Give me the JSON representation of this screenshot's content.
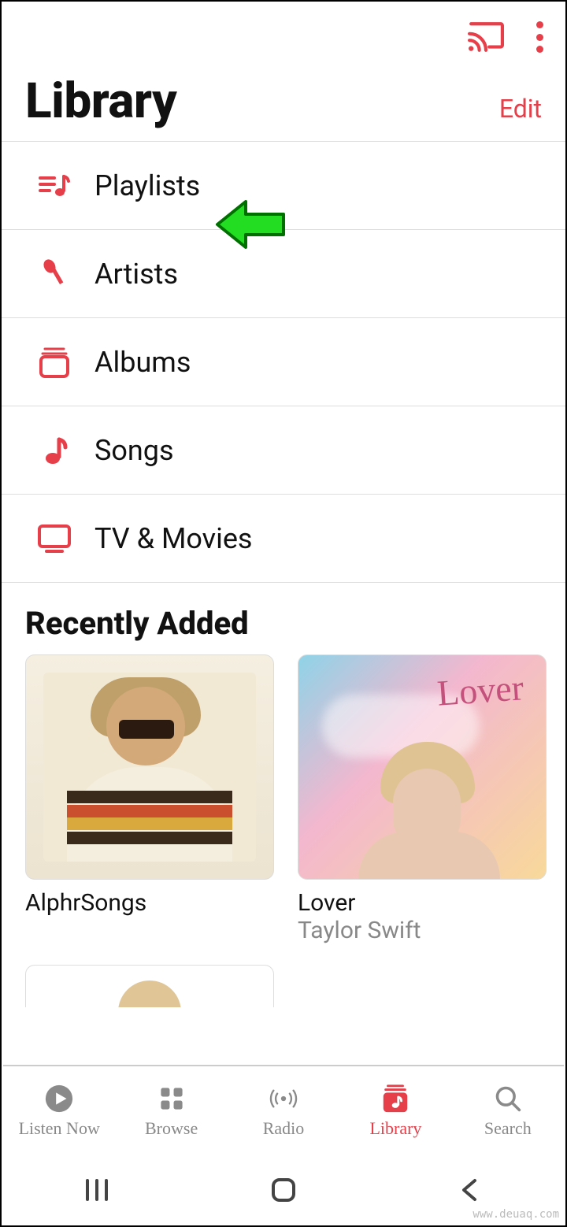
{
  "colors": {
    "accent": "#e63f4a"
  },
  "header": {
    "title": "Library",
    "edit": "Edit"
  },
  "menu": [
    {
      "icon": "playlists-icon",
      "label": "Playlists"
    },
    {
      "icon": "artists-icon",
      "label": "Artists"
    },
    {
      "icon": "albums-icon",
      "label": "Albums"
    },
    {
      "icon": "songs-icon",
      "label": "Songs"
    },
    {
      "icon": "tv-movies-icon",
      "label": "TV & Movies"
    }
  ],
  "section_recent": {
    "title": "Recently Added"
  },
  "recent": [
    {
      "title": "AlphrSongs",
      "subtitle": "",
      "art_script": ""
    },
    {
      "title": "Lover",
      "subtitle": "Taylor Swift",
      "art_script": "Lover"
    }
  ],
  "nav": [
    {
      "label": "Listen Now",
      "active": false
    },
    {
      "label": "Browse",
      "active": false
    },
    {
      "label": "Radio",
      "active": false
    },
    {
      "label": "Library",
      "active": true
    },
    {
      "label": "Search",
      "active": false
    }
  ],
  "watermark": "www.deuaq.com"
}
